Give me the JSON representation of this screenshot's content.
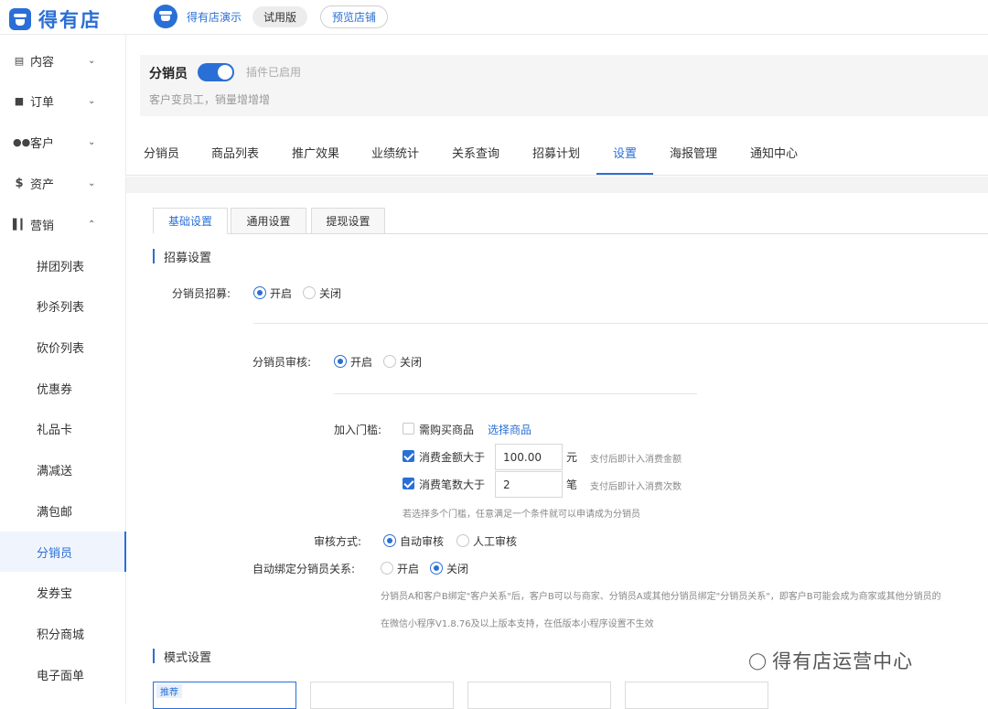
{
  "brand": {
    "name": "得有店",
    "color": "#2a6fd6"
  },
  "header": {
    "store_name": "得有店演示",
    "trial_label": "试用版",
    "preview_label": "预览店铺"
  },
  "sidebar": {
    "groups": [
      {
        "label": "内容",
        "icon": "file-icon",
        "expanded": false
      },
      {
        "label": "订单",
        "icon": "order-icon",
        "expanded": false
      },
      {
        "label": "客户",
        "icon": "users-icon",
        "expanded": false
      },
      {
        "label": "资产",
        "icon": "dollar-icon",
        "expanded": false
      },
      {
        "label": "营销",
        "icon": "chart-icon",
        "expanded": true
      }
    ],
    "marketing_items": [
      "拼团列表",
      "秒杀列表",
      "砍价列表",
      "优惠券",
      "礼品卡",
      "满减送",
      "满包邮",
      "分销员",
      "发券宝",
      "积分商城",
      "电子面单"
    ],
    "active_item": "分销员"
  },
  "plugin": {
    "title": "分销员",
    "enabled": true,
    "status": "插件已启用",
    "description": "客户变员工，销量增增增"
  },
  "tabs": [
    "分销员",
    "商品列表",
    "推广效果",
    "业绩统计",
    "关系查询",
    "招募计划",
    "设置",
    "海报管理",
    "通知中心"
  ],
  "active_tab": "设置",
  "subtabs": [
    "基础设置",
    "通用设置",
    "提现设置"
  ],
  "active_subtab": "基础设置",
  "recruit": {
    "section_title": "招募设置",
    "recruit_label": "分销员招募:",
    "recruit_options": [
      "开启",
      "关闭"
    ],
    "recruit_value": "开启",
    "review_label": "分销员审核:",
    "review_options": [
      "开启",
      "关闭"
    ],
    "review_value": "开启",
    "threshold_label": "加入门槛:",
    "threshold_purchase": {
      "label": "需购买商品",
      "checked": false,
      "link": "选择商品"
    },
    "threshold_amount": {
      "label": "消费金额大于",
      "checked": true,
      "value": "100.00",
      "unit": "元",
      "hint": "支付后即计入消费金额"
    },
    "threshold_count": {
      "label": "消费笔数大于",
      "checked": true,
      "value": "2",
      "unit": "笔",
      "hint": "支付后即计入消费次数"
    },
    "threshold_note": "若选择多个门槛，任意满足一个条件就可以申请成为分销员",
    "audit_label": "审核方式:",
    "audit_options": [
      "自动审核",
      "人工审核"
    ],
    "audit_value": "自动审核",
    "bind_label": "自动绑定分销员关系:",
    "bind_options": [
      "开启",
      "关闭"
    ],
    "bind_value": "关闭",
    "bind_note1": "分销员A和客户B绑定\"客户关系\"后，客户B可以与商家、分销员A或其他分销员绑定\"分销员关系\"，即客户B可能会成为商家或其他分销员的",
    "bind_note2": "在微信小程序V1.8.76及以上版本支持，在低版本小程序设置不生效"
  },
  "mode": {
    "section_title": "模式设置",
    "badge": "推荐"
  },
  "watermark": {
    "text": "得有店运营中心"
  }
}
